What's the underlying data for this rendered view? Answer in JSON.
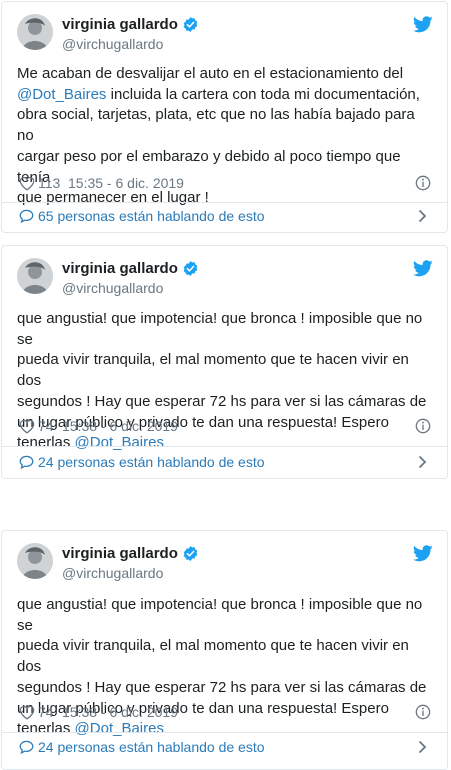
{
  "tweets": [
    {
      "name": "virginia gallardo",
      "handle": "@virchugallardo",
      "text_lines": [
        [
          "Me acaban de desvalijar el auto en el estacionamiento del"
        ],
        [
          "@Dot_Baires",
          " incluida la cartera con toda mi documentación,"
        ],
        [
          "obra social, tarjetas, plata, etc que no las había bajado para no"
        ],
        [
          "cargar peso por el embarazo y debido al poco tiempo que tenía"
        ],
        [
          "que permanecer en el lugar !"
        ]
      ],
      "likes": "113",
      "time": "15:35 - 6 dic. 2019",
      "talking": "65 personas están hablando de esto"
    },
    {
      "name": "virginia gallardo",
      "handle": "@virchugallardo",
      "text_lines": [
        [
          "que angustia! que impotencia! que bronca ! imposible que no se"
        ],
        [
          "pueda vivir tranquila, el mal momento que te hacen vivir en dos"
        ],
        [
          "segundos ! Hay que esperar 72 hs para ver si las cámaras de"
        ],
        [
          "un lugar público y privado te dan una respuesta! Espero"
        ],
        [
          "tenerlas ",
          "@Dot_Baires"
        ]
      ],
      "likes": "74",
      "time": "15:38 - 6 dic. 2019",
      "talking": "24 personas están hablando de esto"
    },
    {
      "name": "virginia gallardo",
      "handle": "@virchugallardo",
      "text_lines": [
        [
          "que angustia! que impotencia! que bronca ! imposible que no se"
        ],
        [
          "pueda vivir tranquila, el mal momento que te hacen vivir en dos"
        ],
        [
          "segundos ! Hay que esperar 72 hs para ver si las cámaras de"
        ],
        [
          "un lugar público y privado te dan una respuesta! Espero"
        ],
        [
          "tenerlas ",
          "@Dot_Baires"
        ]
      ],
      "likes": "74",
      "time": "15:38 - 6 dic. 2019",
      "talking": "24 personas están hablando de esto"
    }
  ],
  "icons": {
    "verified": "verified-badge-icon",
    "bird": "twitter-bird-icon",
    "heart": "heart-icon",
    "info": "info-icon",
    "bubble": "speech-bubble-icon",
    "chevron": "chevron-right-icon"
  },
  "colors": {
    "link": "#2b7bb9",
    "muted": "#697882",
    "twitter_blue": "#1da1f2",
    "border": "#e1e8ed"
  }
}
